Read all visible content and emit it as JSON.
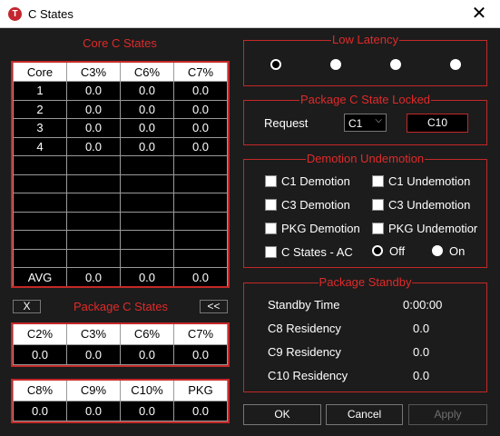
{
  "window": {
    "title": "C States",
    "icon_letter": "T"
  },
  "core_c_states": {
    "title": "Core C States",
    "headers": [
      "Core",
      "C3%",
      "C6%",
      "C7%"
    ],
    "rows": [
      [
        "1",
        "0.0",
        "0.0",
        "0.0"
      ],
      [
        "2",
        "0.0",
        "0.0",
        "0.0"
      ],
      [
        "3",
        "0.0",
        "0.0",
        "0.0"
      ],
      [
        "4",
        "0.0",
        "0.0",
        "0.0"
      ]
    ],
    "avg": [
      "AVG",
      "0.0",
      "0.0",
      "0.0"
    ]
  },
  "package_c_states": {
    "title": "Package C States",
    "x_button": "X",
    "back_button": "<<",
    "table1_headers": [
      "C2%",
      "C3%",
      "C6%",
      "C7%"
    ],
    "table1_values": [
      "0.0",
      "0.0",
      "0.0",
      "0.0"
    ],
    "table2_headers": [
      "C8%",
      "C9%",
      "C10%",
      "PKG"
    ],
    "table2_values": [
      "0.0",
      "0.0",
      "0.0",
      "0.0"
    ]
  },
  "low_latency": {
    "title": "Low Latency"
  },
  "package_locked": {
    "title": "Package C State Locked",
    "request_label": "Request",
    "request_value": "C1",
    "locked_value": "C10"
  },
  "demotion": {
    "title": "Demotion Undemotion",
    "c1_demotion": "C1 Demotion",
    "c1_undemotion": "C1 Undemotion",
    "c3_demotion": "C3 Demotion",
    "c3_undemotion": "C3 Undemotion",
    "pkg_demotion": "PKG Demotion",
    "pkg_undemotion": "PKG Undemotior",
    "c_states_ac": "C States - AC",
    "off_label": "Off",
    "on_label": "On"
  },
  "package_standby": {
    "title": "Package Standby",
    "standby_time_label": "Standby Time",
    "standby_time_value": "0:00:00",
    "c8_label": "C8 Residency",
    "c8_value": "0.0",
    "c9_label": "C9 Residency",
    "c9_value": "0.0",
    "c10_label": "C10 Residency",
    "c10_value": "0.0"
  },
  "footer": {
    "ok": "OK",
    "cancel": "Cancel",
    "apply": "Apply"
  },
  "colors": {
    "accent_red": "#c42828",
    "background": "#1c1c1c"
  }
}
